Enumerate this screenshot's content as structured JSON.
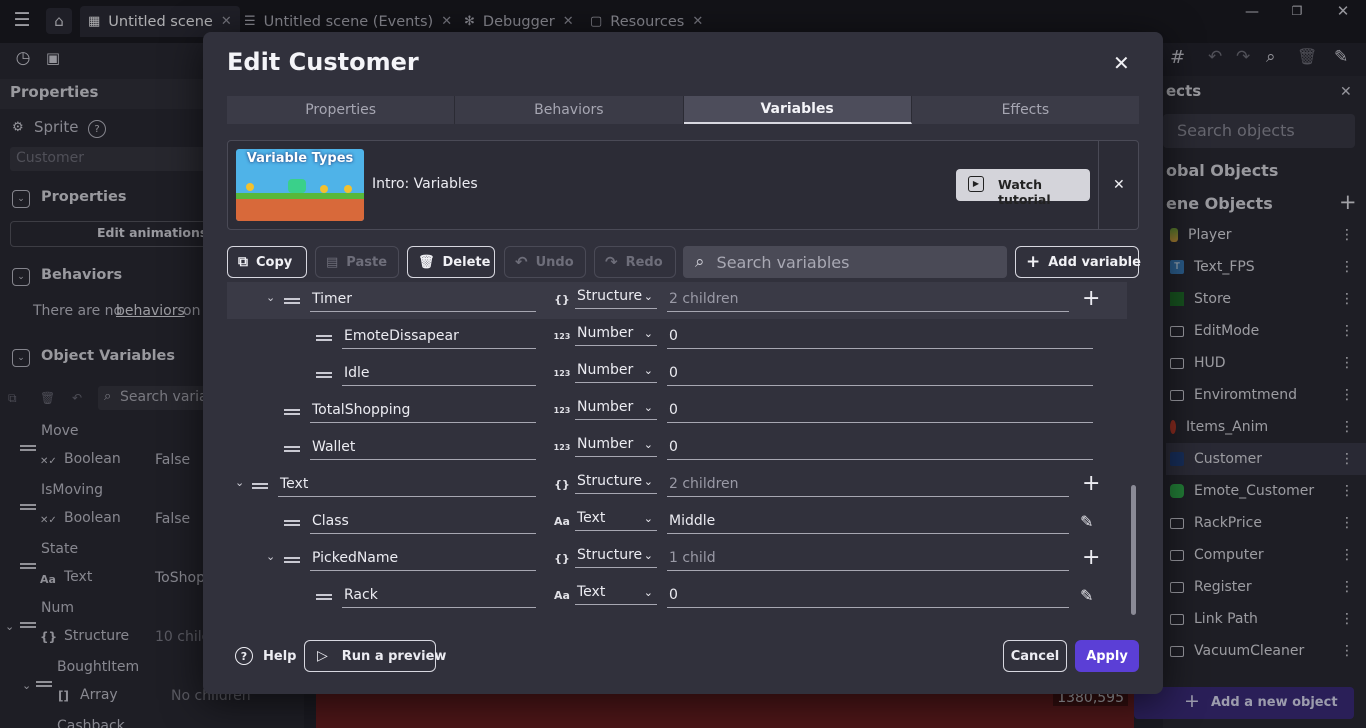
{
  "window": {
    "tabs": [
      {
        "label": "Untitled scene",
        "active": true
      },
      {
        "label": "Untitled scene (Events)",
        "active": false
      },
      {
        "label": "Debugger",
        "active": false
      },
      {
        "label": "Resources",
        "active": false
      }
    ]
  },
  "left_panel": {
    "title": "Properties",
    "object_type": "Sprite",
    "object_name_placeholder": "Customer",
    "properties_heading": "Properties",
    "edit_animations": "Edit animations",
    "behaviors_heading": "Behaviors",
    "behaviors_note": "There are no",
    "behaviors_link": "behaviors",
    "behaviors_tail": "on",
    "object_variables_heading": "Object Variables",
    "search_placeholder": "Search variab",
    "vars": [
      {
        "name": "Move",
        "type": "Boolean",
        "value": "False"
      },
      {
        "name": "IsMoving",
        "type": "Boolean",
        "value": "False"
      },
      {
        "name": "State",
        "type": "Text",
        "value": "ToShop"
      },
      {
        "name": "Num",
        "type": "Structure",
        "value": "10 child"
      },
      {
        "name": "BoughtItem",
        "type": "Array",
        "value": "No children"
      },
      {
        "name": "Cashback",
        "type": "",
        "value": ""
      }
    ]
  },
  "right_panel": {
    "title": "ects",
    "search_placeholder": "Search objects",
    "global_objects": "obal Objects",
    "scene_objects": "ene Objects",
    "objects": [
      "Player",
      "Text_FPS",
      "Store",
      "EditMode",
      "HUD",
      "Enviromtmend",
      "Items_Anim",
      "Customer",
      "Emote_Customer",
      "RackPrice",
      "Computer",
      "Register",
      "Link Path",
      "VacuumCleaner"
    ],
    "add_object": "Add a new object"
  },
  "canvas": {
    "coords": "1380,595"
  },
  "dialog": {
    "title": "Edit Customer",
    "tabs": [
      "Properties",
      "Behaviors",
      "Variables",
      "Effects"
    ],
    "active_tab": "Variables",
    "tutorial": {
      "thumbnail_title": "Variable Types",
      "label": "Intro: Variables",
      "watch_button": "Watch tutorial"
    },
    "toolbar": {
      "copy": "Copy",
      "paste": "Paste",
      "delete": "Delete",
      "undo": "Undo",
      "redo": "Redo",
      "search_placeholder": "Search variables",
      "add_variable": "Add variable"
    },
    "rows": [
      {
        "name": "Timer",
        "type": "Structure",
        "value": "2 children"
      },
      {
        "name": "EmoteDissapear",
        "type": "Number",
        "value": "0"
      },
      {
        "name": "Idle",
        "type": "Number",
        "value": "0"
      },
      {
        "name": "TotalShopping",
        "type": "Number",
        "value": "0"
      },
      {
        "name": "Wallet",
        "type": "Number",
        "value": "0"
      },
      {
        "name": "Text",
        "type": "Structure",
        "value": "2 children"
      },
      {
        "name": "Class",
        "type": "Text",
        "value": "Middle"
      },
      {
        "name": "PickedName",
        "type": "Structure",
        "value": "1 child"
      },
      {
        "name": "Rack",
        "type": "Text",
        "value": "0"
      }
    ],
    "footer": {
      "help": "Help",
      "run_preview": "Run a preview",
      "cancel": "Cancel",
      "apply": "Apply"
    }
  },
  "colors": {
    "accent": "#5b3fd6",
    "dialog_bg": "#31313c",
    "panel_bg": "#2a2a34",
    "canvas_red": "#6b1f22"
  }
}
